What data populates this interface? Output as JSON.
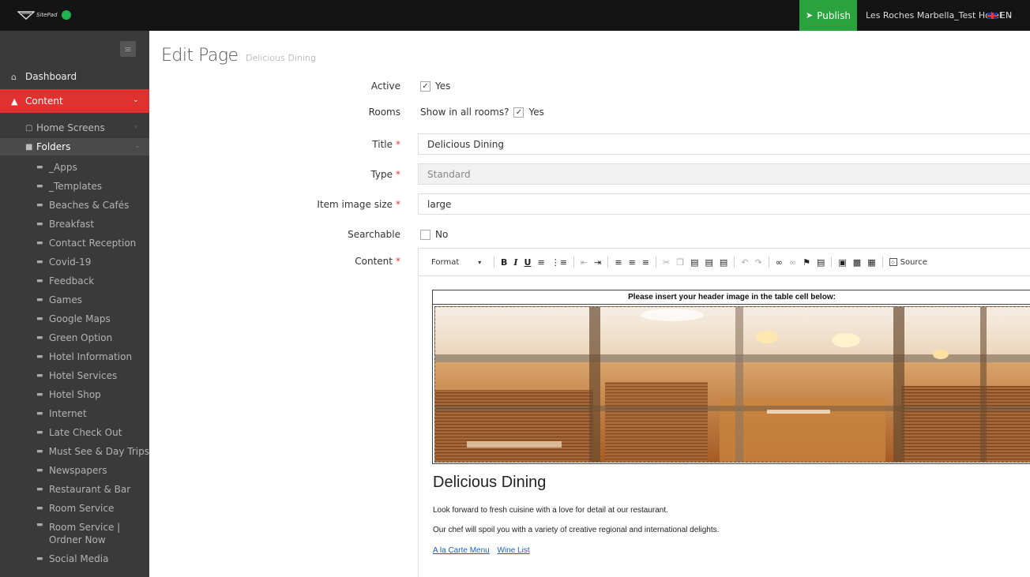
{
  "topbar": {
    "logo_text": "SitePad",
    "status_color": "#22b14c",
    "publish_label": "Publish",
    "publish_color": "#2aa33f",
    "hotel": "Les Roches Marbella_Test Hotel",
    "language": "EN"
  },
  "sidebar": {
    "dashboard": "Dashboard",
    "content": "Content",
    "content_color": "#e03131",
    "home_screens": "Home Screens",
    "folders": "Folders",
    "folder_items": [
      "_Apps",
      "_Templates",
      "Beaches & Cafés",
      "Breakfast",
      "Contact Reception",
      "Covid-19",
      "Feedback",
      "Games",
      "Google Maps",
      "Green Option",
      "Hotel Information",
      "Hotel Services",
      "Hotel Shop",
      "Internet",
      "Late Check Out",
      "Must See & Day Trips",
      "Newspapers",
      "Restaurant & Bar",
      "Room Service",
      "Room Service | Ordner Now",
      "Social Media"
    ]
  },
  "page": {
    "title": "Edit Page",
    "subtitle": "Delicious Dining"
  },
  "form": {
    "active_label": "Active",
    "active_value": "Yes",
    "rooms_label": "Rooms",
    "rooms_question": "Show in all rooms?",
    "rooms_value": "Yes",
    "title_label": "Title",
    "title_value": "Delicious Dining",
    "type_label": "Type",
    "type_value": "Standard",
    "image_size_label": "Item image size",
    "image_size_value": "large",
    "searchable_label": "Searchable",
    "searchable_value": "No",
    "content_label": "Content",
    "required_mark": "*"
  },
  "editor": {
    "format_label": "Format",
    "source_label": "Source",
    "header_caption": "Please insert your header image in the table cell below:",
    "doc_title": "Delicious Dining",
    "paragraph_1": "Look forward to fresh cuisine with a love for detail at our restaurant.",
    "paragraph_2": "Our chef will spoil you with a variety of creative regional and international delights.",
    "link_1": "A la Carte Menu",
    "link_2": "Wine List"
  }
}
